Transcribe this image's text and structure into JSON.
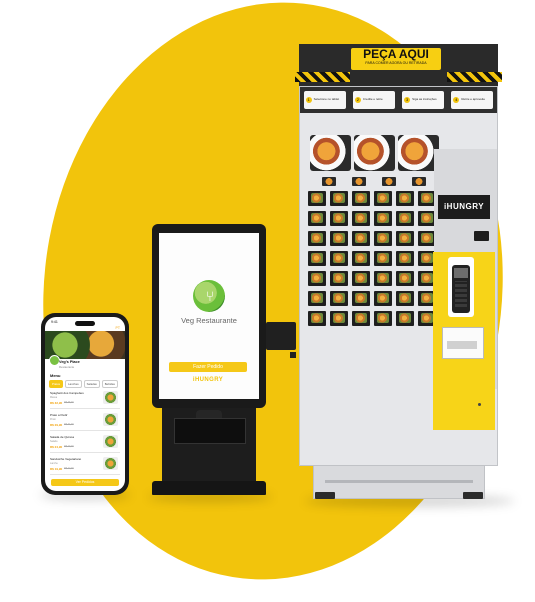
{
  "colors": {
    "accent": "#f2c40c",
    "dark": "#1a1a1a",
    "machine": "#e6e7ea"
  },
  "vending_machine": {
    "sign_title": "PEÇA AQUI",
    "sign_subtitle": "PARA COMER AGORA OU RETIRADA",
    "brand": "iHUNGRY",
    "steps": [
      {
        "num": "1",
        "text": "Selecione no tablet"
      },
      {
        "num": "2",
        "text": "Credite e retire"
      },
      {
        "num": "3",
        "text": "Siga as instruções"
      },
      {
        "num": "4",
        "text": "Retire e aproveite"
      }
    ]
  },
  "kiosk": {
    "restaurant_name": "Veg Restaurante",
    "order_button": "Fazer Pedido",
    "brand": "iHUNGRY",
    "logo_icon": "leaf-fork-icon"
  },
  "phone": {
    "status_time": "9:41",
    "language": "PT",
    "restaurant_name": "Veg's Place",
    "restaurant_sub": "Restaurante",
    "menu_title": "Menu",
    "tabs": [
      "Pratos",
      "Lanches",
      "Saladas",
      "Bebidas"
    ],
    "items": [
      {
        "name": "Spaghetti dos Campeões",
        "desc": "Massa",
        "price": "R$ 32,90",
        "old": "R$ 38,90"
      },
      {
        "name": "Prato a Pedir",
        "desc": "Prato",
        "price": "R$ 29,90",
        "old": "R$ 34,90"
      },
      {
        "name": "Salada de Quinoa",
        "desc": "Salada",
        "price": "R$ 24,90",
        "old": "R$ 29,90"
      },
      {
        "name": "Sanduíche Vegetariano",
        "desc": "Lanche",
        "price": "R$ 19,90",
        "old": "R$ 22,90"
      }
    ],
    "order_button": "Ver Pedidos"
  }
}
